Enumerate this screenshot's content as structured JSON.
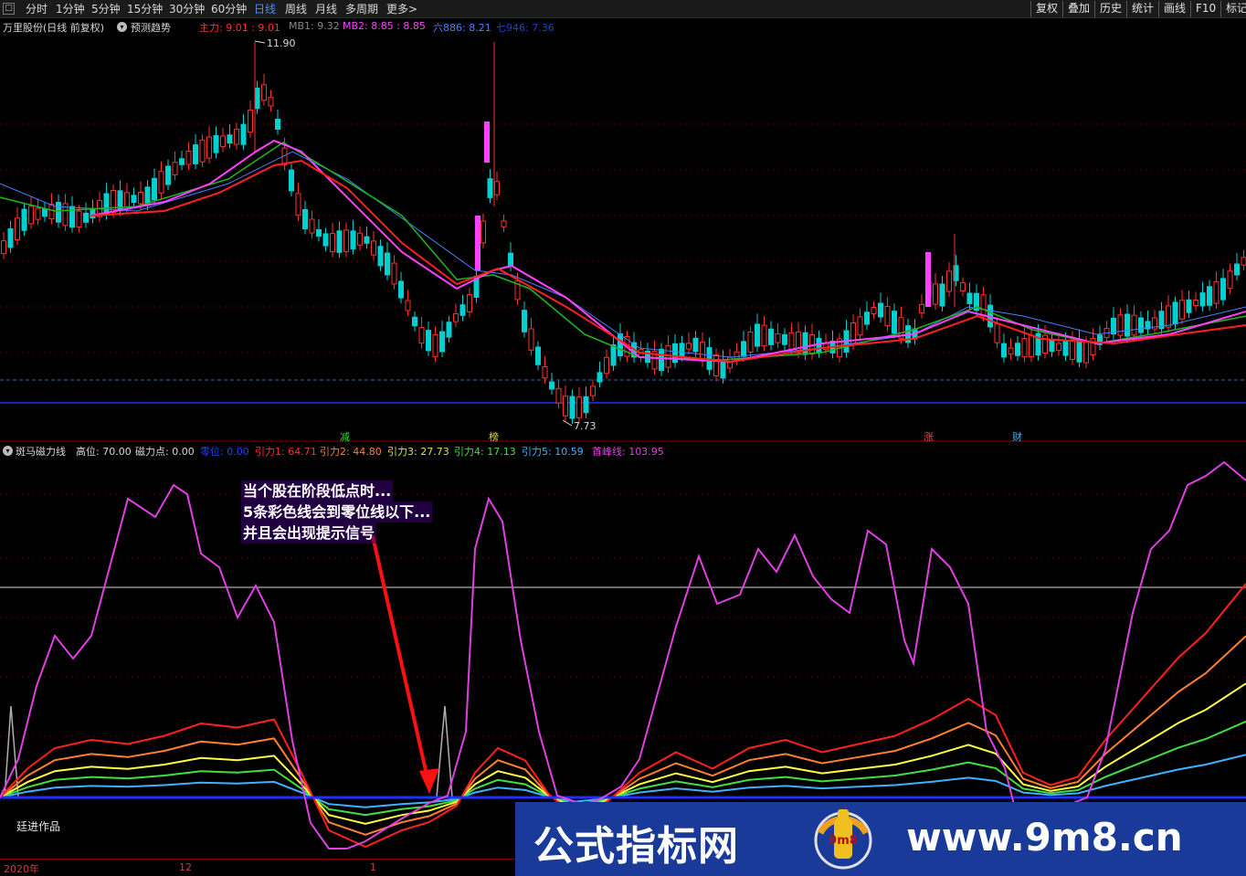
{
  "toolbar": {
    "period_tabs": [
      "分时",
      "1分钟",
      "5分钟",
      "15分钟",
      "30分钟",
      "60分钟",
      "日线",
      "周线",
      "月线",
      "多周期",
      "更多>"
    ],
    "active_tab": "日线",
    "buttons": [
      "复权",
      "叠加",
      "历史",
      "统计",
      "画线",
      "F10",
      "标记"
    ]
  },
  "main_header": {
    "title": "万里股份(日线 前复权)",
    "forecast": "预测趋势",
    "ind_main": "主力: 9.01 : 9.01",
    "ind_mb1": "MB1: 9.32",
    "ind_mb2": "MB2: 8.85 : 8.85",
    "ind_six": "六886: 8.21",
    "ind_seven": "七946: 7.36"
  },
  "price_labels": {
    "high": "11.90",
    "low": "7.73"
  },
  "signals": [
    "减",
    "榜",
    "涨",
    "财"
  ],
  "sub_header": {
    "title": "斑马磁力线",
    "high": "高位: 70.00",
    "magnet": "磁力点: 0.00",
    "zero": "零位: 0.00",
    "pull1": "引力1: 64.71",
    "pull2": "引力2: 44.80",
    "pull3": "引力3: 27.73",
    "pull4": "引力4: 17.13",
    "pull5": "引力5: 10.59",
    "peak": "首峰线: 103.95"
  },
  "annotation": [
    "当个股在阶段低点时...",
    "5条彩色线会到零位线以下...",
    "并且会出现提示信号"
  ],
  "author": "廷进作品",
  "dates": [
    "2020年",
    "12",
    "1"
  ],
  "watermark": {
    "left_text": "公式指标网",
    "right_text": "www.9m8.cn",
    "logo_text": "9m8"
  },
  "colors": {
    "up": "#ff3030",
    "down": "#00d0d0",
    "ma_magenta": "#ff40ff",
    "ma_red": "#ff2020",
    "ma_green": "#20b020",
    "ma_blue": "#4a80ff",
    "pull1": "#ff2020",
    "pull2": "#ff8030",
    "pull3": "#ffff40",
    "pull4": "#40e040",
    "pull5": "#40b0ff",
    "peak": "#e040e0"
  }
}
